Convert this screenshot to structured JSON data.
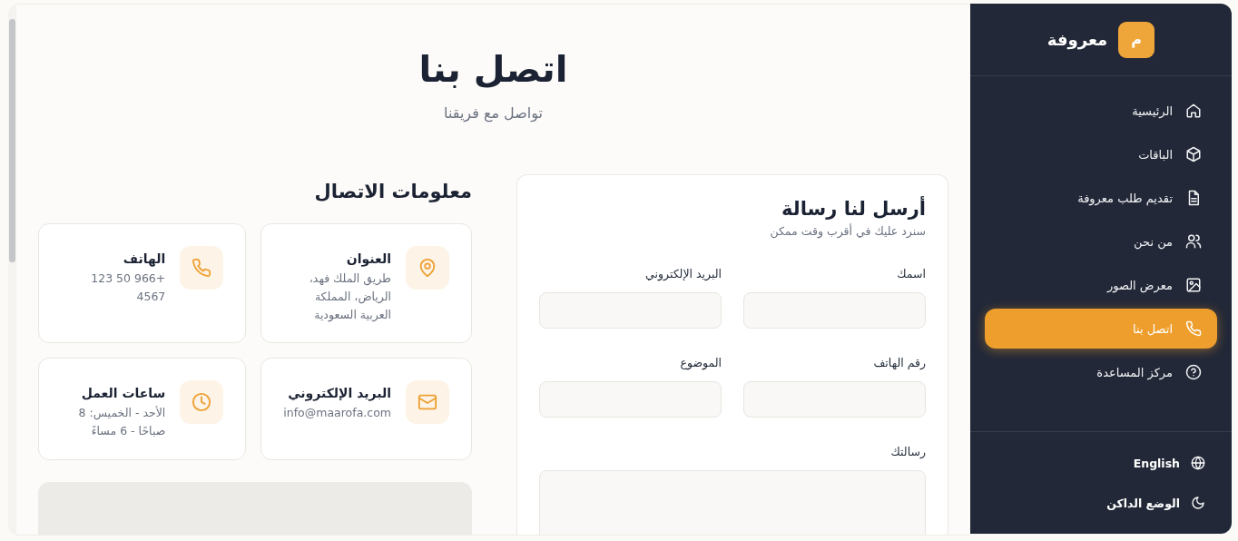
{
  "sidebar": {
    "brand": {
      "logo_letter": "م",
      "name": "معروفة"
    },
    "nav": [
      {
        "label": "الرئيسية",
        "selected": false
      },
      {
        "label": "الباقات",
        "selected": false
      },
      {
        "label": "تقديم طلب معروفة",
        "selected": false
      },
      {
        "label": "من نحن",
        "selected": false
      },
      {
        "label": "معرض الصور",
        "selected": false
      },
      {
        "label": "اتصل بنا",
        "selected": true
      },
      {
        "label": "مركز المساعدة",
        "selected": false
      }
    ],
    "footer": [
      {
        "label": "English"
      },
      {
        "label": "الوضع الداكن"
      }
    ]
  },
  "header": {
    "title": "اتصل بنا",
    "subtitle": "تواصل مع فريقنا"
  },
  "form": {
    "title": "أرسل لنا رسالة",
    "subtitle": "سنرد عليك في أقرب وقت ممكن",
    "fields": [
      {
        "label": "اسمك",
        "kind": "input"
      },
      {
        "label": "البريد الإلكتروني",
        "kind": "input"
      },
      {
        "label": "رقم الهاتف",
        "kind": "input"
      },
      {
        "label": "الموضوع",
        "kind": "input"
      },
      {
        "label": "رسالتك",
        "kind": "textarea"
      }
    ]
  },
  "contact_info": {
    "title": "معلومات الاتصال",
    "cards": [
      {
        "title": "العنوان",
        "text": "طريق الملك فهد، الرياض، المملكة العربية السعودية"
      },
      {
        "title": "الهاتف",
        "text": "+966 50 123 4567"
      },
      {
        "title": "البريد الإلكتروني",
        "text": "info@maarofa.com"
      },
      {
        "title": "ساعات العمل",
        "text": "الأحد - الخميس: 8 صباحًا - 6 مساءً"
      }
    ]
  }
}
